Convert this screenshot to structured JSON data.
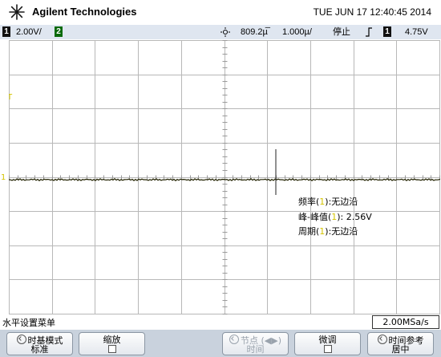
{
  "header": {
    "brand": "Agilent Technologies",
    "datetime": "TUE JUN 17 12:40:45 2014"
  },
  "status": {
    "ch1_label": "1",
    "ch1_scale": "2.00V/",
    "ch2_label": "2",
    "delay": "809.2µ̅",
    "timebase": "1.000µ/",
    "run_state": "停止",
    "trigger_source": "1",
    "trigger_level": "4.75V"
  },
  "screen": {
    "ch1_marker": "1",
    "measurements": [
      {
        "name": "频率(",
        "ch": "1",
        "rest": "):无边沿"
      },
      {
        "name": "峰-峰值(",
        "ch": "1",
        "rest": "): 2.56V"
      },
      {
        "name": "周期(",
        "ch": "1",
        "rest": "):无边沿"
      }
    ]
  },
  "menu": {
    "title": "水平设置菜单",
    "sample_rate": "2.00MSa/s",
    "buttons": [
      {
        "line1": "时基模式",
        "line2": "标准"
      },
      {
        "line1": "缩放",
        "line2": ""
      },
      {
        "line1": "节点 (◀▶)",
        "line2": "时间"
      },
      {
        "line1": "微调",
        "line2": ""
      },
      {
        "line1": "时间参考",
        "line2": "居中"
      }
    ]
  },
  "colors": {
    "ch1": "#d4c400",
    "ch2": "#00a000",
    "trace": "#1e1e00",
    "grid": "#b0b0b0",
    "menubar": "#c9d2dd"
  }
}
